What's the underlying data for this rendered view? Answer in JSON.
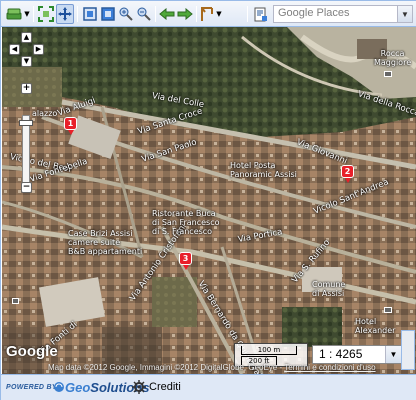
{
  "toolbar": {
    "search_placeholder": "Google Places",
    "icons": [
      "layer-icon",
      "dropdown-icon",
      "zoom-extent-icon",
      "pan-icon",
      "zoom-in-box-icon",
      "zoom-out-box-icon",
      "measure-icon",
      "measure-area-icon",
      "back-icon",
      "forward-icon",
      "coordinate-icon",
      "print-icon"
    ]
  },
  "map": {
    "roads": [
      "Via del Colle",
      "Via della Rocca",
      "Via Santa Croce",
      "Via Giovanni",
      "Via San Paolo",
      "Vicolo del Bovi",
      "Vicolo Sant'Andrea",
      "Via Fontebella",
      "Via Portica",
      "Via Antonio Cristofani",
      "Via Bernardo da Quintavalle",
      "Via Aluigi",
      "Via Fonti di",
      "Via S. Rufino"
    ],
    "places": {
      "rocca": "Rocca\nMaggiore",
      "hotel_posta": "Hotel Posta\nPanoramic Assisi",
      "ristorante": "Ristorante Buca\ndi San Francesco\ndi S. Francesco",
      "case_brizi": "Case Brizi Assisi\ncamere suite\nB&B appartamenti",
      "comune": "Comune\ndi Assisi",
      "hotel_alexander": "Hotel\nAlexander",
      "palazzo": "alazzo"
    },
    "markers": [
      "1",
      "2",
      "3"
    ]
  },
  "logo": "Google",
  "scale": {
    "top": "100 m",
    "bottom": "200 ft",
    "ratio": "1 : 4265"
  },
  "attribution": {
    "text": "Map data ©2012 Google, Immagini ©2012 DigitalGlobe, GeoEye - ",
    "link": "Termini e condizioni d'uso"
  },
  "footer": {
    "powered": "POWERED BY",
    "brand_prefix": "Geo",
    "brand_suffix": "Solutions",
    "credits": "Crediti"
  }
}
